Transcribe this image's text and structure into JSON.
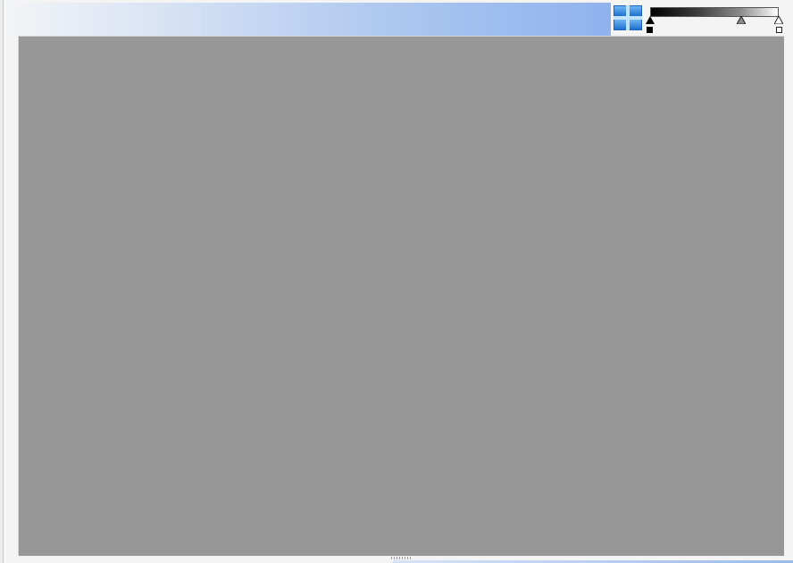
{
  "window": {
    "header_colors": [
      "#f3f4f6",
      "#8fb3ee"
    ],
    "canvas_color": "#979797"
  },
  "toolbar": {
    "view_icon": "grid-view-icon"
  },
  "gradient_editor": {
    "colors": [
      "#000000",
      "#8a8a8a",
      "#ffffff"
    ],
    "stops": [
      {
        "name": "black-stop",
        "position": 0.0,
        "color": "#000000"
      },
      {
        "name": "midpoint-stop",
        "position": 0.7,
        "color": "#8a8a8a"
      },
      {
        "name": "white-stop",
        "position": 1.0,
        "color": "#ffffff"
      }
    ],
    "start_swatch": "#000000",
    "end_swatch": "#ffffff"
  }
}
